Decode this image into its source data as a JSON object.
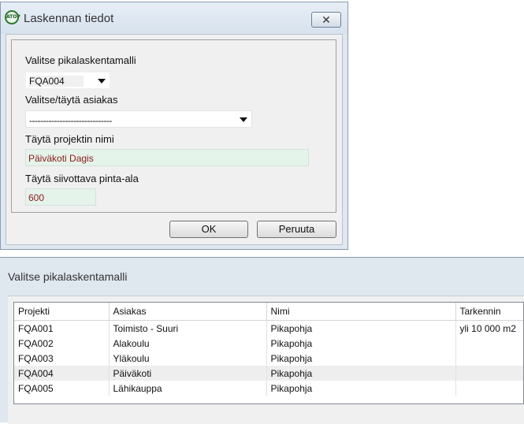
{
  "dialog": {
    "title": "Laskennan tiedot",
    "app_icon_text": "ATOP",
    "close_glyph": "✕",
    "model_label": "Valitse pikalaskentamalli",
    "model_value": "FQA004",
    "customer_label": "Valitse/täytä asiakas",
    "customer_value": "------------------------------",
    "project_label": "Täytä projektin nimi",
    "project_value": "Päiväkoti Dagis",
    "area_label": "Täytä siivottava pinta-ala",
    "area_value": "600",
    "ok_label": "OK",
    "cancel_label": "Peruuta",
    "colors": {
      "field_bg": "#e4f4ea",
      "field_text": "#8b1a1a",
      "frame": "#dfe7ef"
    }
  },
  "picker": {
    "title": "Valitse pikalaskentamalli",
    "columns": [
      "Projekti",
      "Asiakas",
      "Nimi",
      "Tarkennin"
    ],
    "rows": [
      [
        "FQA001",
        "Toimisto - Suuri",
        "Pikapohja",
        "yli 10 000 m2"
      ],
      [
        "FQA002",
        "Alakoulu",
        "Pikapohja",
        ""
      ],
      [
        "FQA003",
        "Yläkoulu",
        "Pikapohja",
        ""
      ],
      [
        "FQA004",
        "Päiväkoti",
        "Pikapohja",
        ""
      ],
      [
        "FQA005",
        "Lähikauppa",
        "Pikapohja",
        ""
      ]
    ],
    "selected_row": "FQA004"
  }
}
